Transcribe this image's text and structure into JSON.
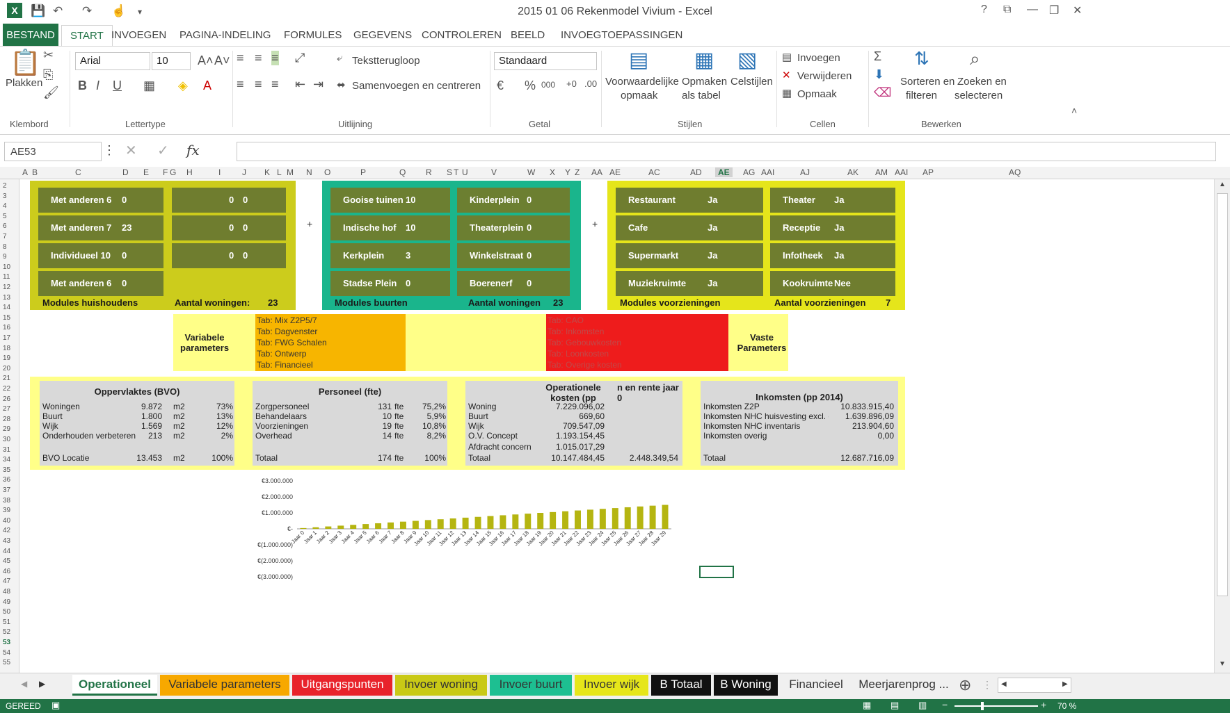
{
  "window": {
    "title": "2015 01 06 Rekenmodel Vivium - Excel",
    "controls": [
      "?",
      "⧉",
      "—",
      "❐",
      "✕"
    ]
  },
  "ribbon_tabs": [
    "BESTAND",
    "START",
    "INVOEGEN",
    "PAGINA-INDELING",
    "FORMULES",
    "GEGEVENS",
    "CONTROLEREN",
    "BEELD",
    "INVOEGTOEPASSINGEN"
  ],
  "ribbon": {
    "paste": "Plakken",
    "font": "Arial",
    "size": "10",
    "wrap": "Tekstterugloop",
    "merge": "Samenvoegen en centreren",
    "number_format": "Standaard",
    "cond_format": [
      "Voorwaardelijke",
      "opmaak"
    ],
    "format_table": [
      "Opmaken",
      "als tabel"
    ],
    "cell_styles": "Celstijlen",
    "insert": "Invoegen",
    "delete": "Verwijderen",
    "format": "Opmaak",
    "sort": [
      "Sorteren en",
      "filteren"
    ],
    "find": [
      "Zoeken en",
      "selecteren"
    ],
    "groups": [
      "Klembord",
      "Lettertype",
      "Uitlijning",
      "Getal",
      "Stijlen",
      "Cellen",
      "Bewerken"
    ]
  },
  "formula_bar": {
    "namebox": "AE53",
    "fx": "fx"
  },
  "columns": [
    "A",
    "B",
    "C",
    "D",
    "E",
    "F",
    "G",
    "H",
    "I",
    "J",
    "K",
    "L",
    "M",
    "N",
    "O",
    "P",
    "Q",
    "R",
    "S",
    "T",
    "U",
    "V",
    "W",
    "X",
    "Y",
    "Z",
    "AA",
    "AE",
    "AC",
    "AD",
    "AE",
    "AG",
    "AAI",
    "AJ",
    "AK",
    "AM",
    "AAI",
    "AP",
    "AQ"
  ],
  "rows": [
    "2",
    "3",
    "4",
    "5",
    "6",
    "7",
    "8",
    "9",
    "10",
    "11",
    "12",
    "13",
    "14",
    "15",
    "16",
    "17",
    "18",
    "19",
    "20",
    "21",
    "22",
    "26",
    "27",
    "28",
    "29",
    "30",
    "31",
    "34",
    "35",
    "36",
    "37",
    "38",
    "39",
    "40",
    "42",
    "43",
    "44",
    "45",
    "46",
    "47",
    "48",
    "49",
    "50",
    "51",
    "52",
    "53",
    "54",
    "55"
  ],
  "households": {
    "cells": [
      {
        "label": "Met anderen 6",
        "value": "0"
      },
      {
        "label": "Met anderen 7",
        "value": "23"
      },
      {
        "label": "Individueel 10",
        "value": "0"
      },
      {
        "label": "Met anderen 6",
        "value": "0"
      }
    ],
    "right_cells": [
      [
        "0",
        "0"
      ],
      [
        "0",
        "0"
      ],
      [
        "0",
        "0"
      ]
    ],
    "footer_left": "Modules huishoudens",
    "footer_right": "Aantal woningen:",
    "footer_value": "23"
  },
  "neighbourhoods": {
    "left": [
      {
        "label": "Gooise tuinen",
        "value": "10"
      },
      {
        "label": "Indische hof",
        "value": "10"
      },
      {
        "label": "Kerkplein",
        "value": "3"
      },
      {
        "label": "Stadse Plein",
        "value": "0"
      }
    ],
    "right": [
      {
        "label": "Kinderplein",
        "value": "0"
      },
      {
        "label": "Theaterplein",
        "value": "0"
      },
      {
        "label": "Winkelstraat",
        "value": "0"
      },
      {
        "label": "Boerenerf",
        "value": "0"
      }
    ],
    "footer_left": "Modules buurten",
    "footer_right": "Aantal woningen",
    "footer_value": "23"
  },
  "facilities": {
    "left": [
      {
        "label": "Restaurant",
        "value": "Ja"
      },
      {
        "label": "Cafe",
        "value": "Ja"
      },
      {
        "label": "Supermarkt",
        "value": "Ja"
      },
      {
        "label": "Muziekruimte",
        "value": "Ja"
      }
    ],
    "right": [
      {
        "label": "Theater",
        "value": "Ja"
      },
      {
        "label": "Receptie",
        "value": "Ja"
      },
      {
        "label": "Infotheek",
        "value": "Ja"
      },
      {
        "label": "Kookruimte",
        "value": "Nee"
      }
    ],
    "footer_left": "Modules voorzieningen",
    "footer_right": "Aantal voorzieningen",
    "footer_value": "7"
  },
  "plus_signs": [
    "+",
    "+"
  ],
  "params": {
    "variable_label": "Variabele parameters",
    "variable_tabs": [
      "Tab: Mix Z2P5/7",
      "Tab: Dagvenster",
      "Tab: FWG Schalen",
      "Tab: Ontwerp",
      "Tab: Financieel"
    ],
    "fixed_label": "Vaste Parameters",
    "fixed_tabs": [
      "Tab: CAO",
      "Tab: Inkomsten",
      "Tab: Gebouwkosten",
      "Tab: Loonkosten",
      "Tab: Overige kosten"
    ]
  },
  "summary": {
    "bvo": {
      "title": "Oppervlaktes (BVO)",
      "rows": [
        [
          "Woningen",
          "9.872",
          "m2",
          "73%"
        ],
        [
          "Buurt",
          "1.800",
          "m2",
          "13%"
        ],
        [
          "Wijk",
          "1.569",
          "m2",
          "12%"
        ],
        [
          "Onderhouden verbeteren",
          "213",
          "m2",
          "2%"
        ]
      ],
      "total": [
        "BVO Locatie",
        "13.453",
        "m2",
        "100%"
      ]
    },
    "personeel": {
      "title": "Personeel (fte)",
      "rows": [
        [
          "Zorgpersoneel",
          "131",
          "fte",
          "75,2%"
        ],
        [
          "Behandelaars",
          "10",
          "fte",
          "5,9%"
        ],
        [
          "Voorzieningen",
          "19",
          "fte",
          "10,8%"
        ],
        [
          "Overhead",
          "14",
          "fte",
          "8,2%"
        ]
      ],
      "total": [
        "Totaal",
        "174",
        "fte",
        "100%"
      ]
    },
    "kosten": {
      "title1": "Operationele kosten (pp",
      "title2": "n en rente jaar 0",
      "rows": [
        [
          "Woning",
          "7.229.096,02"
        ],
        [
          "Buurt",
          "669,60"
        ],
        [
          "Wijk",
          "709.547,09"
        ],
        [
          "O.V. Concept",
          "1.193.154,45"
        ],
        [
          "Afdracht concern",
          "1.015.017,29"
        ]
      ],
      "total": [
        "Totaal",
        "10.147.484,45",
        "2.448.349,54"
      ]
    },
    "inkomsten": {
      "title": "Inkomsten (pp 2014)",
      "rows": [
        [
          "Inkomsten Z2P",
          "10.833.915,40"
        ],
        [
          "Inkomsten NHC huisvesting excl. da",
          "1.639.896,09"
        ],
        [
          "Inkomsten NHC inventaris",
          "213.904,60"
        ],
        [
          "Inkomsten overig",
          "0,00"
        ]
      ],
      "total": [
        "Totaal",
        "12.687.716,09"
      ]
    }
  },
  "chart_data": {
    "type": "bar",
    "categories": [
      "Jaar 0",
      "Jaar 1",
      "Jaar 2",
      "Jaar 3",
      "Jaar 4",
      "Jaar 5",
      "Jaar 6",
      "Jaar 7",
      "Jaar 8",
      "Jaar 9",
      "Jaar 10",
      "Jaar 11",
      "Jaar 12",
      "Jaar 13",
      "Jaar 14",
      "Jaar 15",
      "Jaar 16",
      "Jaar 17",
      "Jaar 18",
      "Jaar 19",
      "Jaar 20",
      "Jaar 21",
      "Jaar 22",
      "Jaar 23",
      "Jaar 24",
      "Jaar 25",
      "Jaar 26",
      "Jaar 27",
      "Jaar 28",
      "Jaar 29"
    ],
    "values": [
      50000,
      100000,
      150000,
      200000,
      250000,
      300000,
      350000,
      400000,
      450000,
      500000,
      550000,
      600000,
      650000,
      700000,
      750000,
      800000,
      850000,
      900000,
      950000,
      1000000,
      1050000,
      1100000,
      1150000,
      1200000,
      1250000,
      1300000,
      1350000,
      1400000,
      1450000,
      1500000
    ],
    "ylim": [
      -3000000,
      3000000
    ],
    "yticks": [
      "€3.000.000",
      "€2.000.000",
      "€1.000.000",
      "€-",
      "€(1.000.000)",
      "€(2.000.000)",
      "€(3.000.000)"
    ],
    "color": "#b5b511"
  },
  "sheet_tabs": [
    {
      "label": "Operationeel",
      "bg": "#ffffff",
      "fg": "#217346"
    },
    {
      "label": "Variabele parameters",
      "bg": "#f7a800",
      "fg": "#333333"
    },
    {
      "label": "Uitgangspunten",
      "bg": "#e8232b",
      "fg": "#ffffff"
    },
    {
      "label": "Invoer woning",
      "bg": "#c9c916",
      "fg": "#333333"
    },
    {
      "label": "Invoer buurt",
      "bg": "#1dbf91",
      "fg": "#333333"
    },
    {
      "label": "Invoer wijk",
      "bg": "#e6e61a",
      "fg": "#333333"
    },
    {
      "label": "B Totaal",
      "bg": "#111111",
      "fg": "#ffffff"
    },
    {
      "label": "B Woning",
      "bg": "#111111",
      "fg": "#ffffff"
    },
    {
      "label": "Financieel",
      "bg": "#f0f0f0",
      "fg": "#333333"
    },
    {
      "label": "Meerjarenprog ...",
      "bg": "#f0f0f0",
      "fg": "#333333"
    }
  ],
  "status": {
    "left": "GEREED",
    "zoom": "70 %"
  },
  "colors": {
    "olive": "#cccc1c",
    "teal": "#1ab58c",
    "yellow": "#e5e51b",
    "orange": "#f7b500",
    "red": "#ee1c1c",
    "light_yellow": "#ffff88",
    "excel_green": "#217346"
  }
}
